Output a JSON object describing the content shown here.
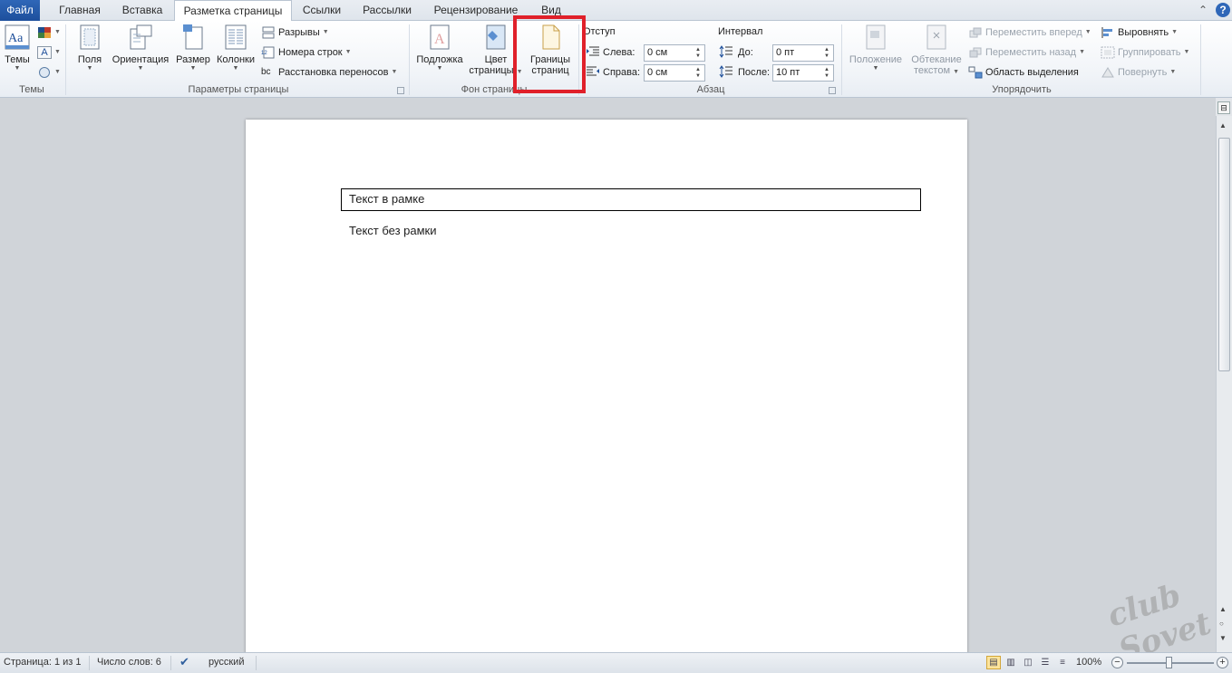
{
  "tabs": [
    {
      "label": "Файл"
    },
    {
      "label": "Главная"
    },
    {
      "label": "Вставка"
    },
    {
      "label": "Разметка страницы"
    },
    {
      "label": "Ссылки"
    },
    {
      "label": "Рассылки"
    },
    {
      "label": "Рецензирование"
    },
    {
      "label": "Вид"
    }
  ],
  "ribbon": {
    "themes": {
      "themes_label": "Темы",
      "group_label": "Темы"
    },
    "page_setup": {
      "margins": "Поля",
      "orientation": "Ориентация",
      "size": "Размер",
      "columns": "Колонки",
      "breaks": "Разрывы",
      "line_numbers": "Номера строк",
      "hyphenation": "Расстановка переносов",
      "group_label": "Параметры страницы"
    },
    "page_background": {
      "watermark": "Подложка",
      "page_color_1": "Цвет",
      "page_color_2": "страницы",
      "page_borders_1": "Границы",
      "page_borders_2": "страниц",
      "group_label": "Фон страницы"
    },
    "paragraph": {
      "indent_title": "Отступ",
      "left_label": "Слева:",
      "left_value": "0 см",
      "right_label": "Справа:",
      "right_value": "0 см",
      "spacing_title": "Интервал",
      "before_label": "До:",
      "before_value": "0 пт",
      "after_label": "После:",
      "after_value": "10 пт",
      "group_label": "Абзац"
    },
    "arrange": {
      "position": "Положение",
      "wrap_1": "Обтекание",
      "wrap_2": "текстом",
      "bring_forward": "Переместить вперед",
      "send_backward": "Переместить назад",
      "selection_pane": "Область выделения",
      "align": "Выровнять",
      "group": "Группировать",
      "rotate": "Повернуть",
      "group_label": "Упорядочить"
    }
  },
  "document": {
    "framed_text": "Текст в рамке",
    "plain_text": "Текст без рамки"
  },
  "status": {
    "page": "Страница: 1 из 1",
    "words": "Число слов: 6",
    "language": "русский",
    "zoom": "100%"
  },
  "watermark_text": "club Sovet",
  "colors": {
    "file_tab": "#2f67b8",
    "highlight": "#e0202a"
  }
}
